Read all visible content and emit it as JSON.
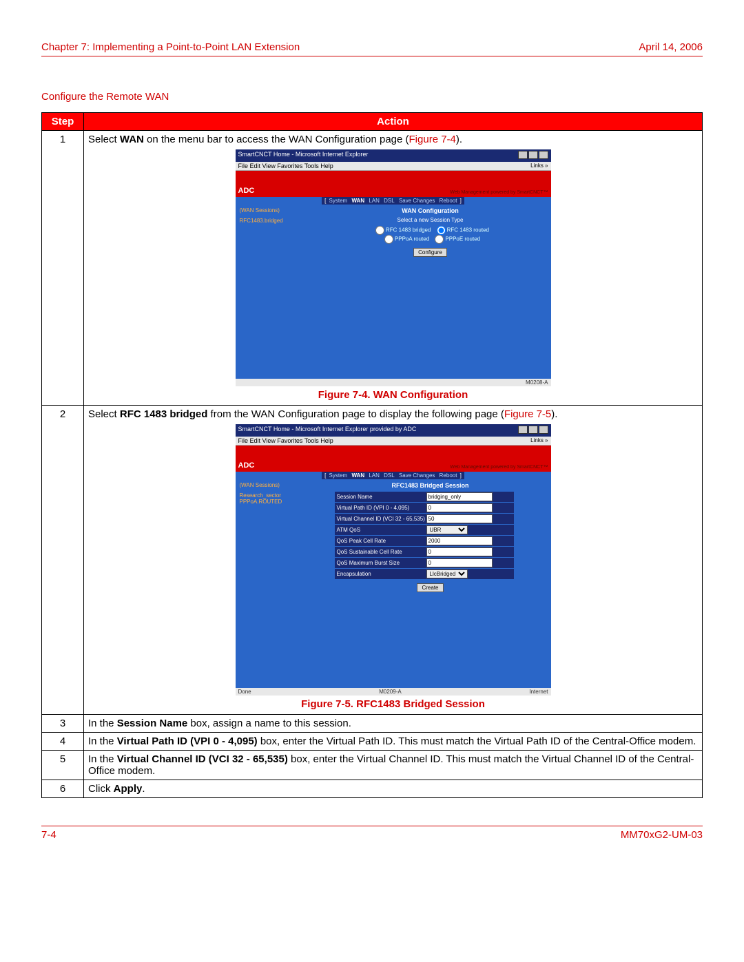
{
  "header": {
    "chapter": "Chapter 7: Implementing a Point-to-Point LAN Extension",
    "date": "April 14, 2006"
  },
  "section_title": "Configure the Remote WAN",
  "table": {
    "headers": {
      "step": "Step",
      "action": "Action"
    },
    "rows": {
      "r1": {
        "num": "1",
        "pre": "Select ",
        "bold": "WAN",
        "post": " on the menu bar to access the WAN Configuration page (",
        "ref": "Figure 7-4",
        "end": ")."
      },
      "r2": {
        "num": "2",
        "pre": "Select ",
        "bold": "RFC 1483 bridged",
        "post": " from the WAN Configuration page to display the following page (",
        "ref": "Figure 7-5",
        "end": ")."
      },
      "r3": {
        "num": "3",
        "pre": "In the ",
        "bold": "Session Name",
        "post": " box, assign a name to this session."
      },
      "r4": {
        "num": "4",
        "pre": "In the ",
        "bold": "Virtual Path ID (VPI 0 - 4,095)",
        "post": " box, enter the Virtual Path ID. This must match the Virtual Path ID of the Central-Office modem."
      },
      "r5": {
        "num": "5",
        "pre": "In the ",
        "bold": "Virtual Channel ID (VCI 32 - 65,535)",
        "post": " box, enter the Virtual Channel ID. This must match the Virtual Channel ID of the Central-Office modem."
      },
      "r6": {
        "num": "6",
        "pre": "Click ",
        "bold": "Apply",
        "post": "."
      }
    }
  },
  "fig1": {
    "caption": "Figure 7-4. WAN Configuration",
    "title": "SmartCNCT Home - Microsoft Internet Explorer",
    "menus": "File  Edit  View  Favorites  Tools  Help",
    "links": "Links »",
    "logo": "ADC",
    "poweredby": "Web Management powered by SmartCNCT™",
    "tabs": {
      "sys": "System",
      "wan": "WAN",
      "lan": "LAN",
      "dsl": "DSL",
      "save": "Save Changes",
      "reboot": "Reboot"
    },
    "side_h": "(WAN Sessions)",
    "side_item": "RFC1483.bridged",
    "main_title": "WAN Configuration",
    "subtitle": "Select a new Session Type",
    "opts": {
      "a": "RFC 1483 bridged",
      "b": "RFC 1483 routed",
      "c": "PPPoA routed",
      "d": "PPPoE routed"
    },
    "btn": "Configure",
    "status_right": "M0208-A"
  },
  "fig2": {
    "caption": "Figure 7-5. RFC1483 Bridged Session",
    "title": "SmartCNCT Home - Microsoft Internet Explorer provided by ADC",
    "menus": "File  Edit  View  Favorites  Tools  Help",
    "links": "Links »",
    "logo": "ADC",
    "poweredby": "Web Management powered by SmartCNCT™",
    "tabs": {
      "sys": "System",
      "wan": "WAN",
      "lan": "LAN",
      "dsl": "DSL",
      "save": "Save Changes",
      "reboot": "Reboot"
    },
    "side_h": "(WAN Sessions)",
    "side_a": "Research_sector",
    "side_b": "PPPoA.ROUTED",
    "main_title": "RFC1483 Bridged Session",
    "fields": {
      "sess_l": "Session Name",
      "sess_v": "bridging_only",
      "vpi_l": "Virtual Path ID (VPI 0 - 4,095)",
      "vpi_v": "0",
      "vci_l": "Virtual Channel ID (VCI 32 - 65,535)",
      "vci_v": "50",
      "atm_l": "ATM QoS",
      "atm_v": "UBR",
      "pcr_l": "QoS Peak Cell Rate",
      "pcr_v": "2000",
      "scr_l": "QoS Sustainable Cell Rate",
      "scr_v": "0",
      "mbs_l": "QoS Maximum Burst Size",
      "mbs_v": "0",
      "enc_l": "Encapsulation",
      "enc_v": "LlcBridged"
    },
    "btn": "Create",
    "status_left": "Done",
    "status_mid": "M0209-A",
    "status_right": "Internet"
  },
  "footer": {
    "left": "7-4",
    "right": "MM70xG2-UM-03"
  }
}
